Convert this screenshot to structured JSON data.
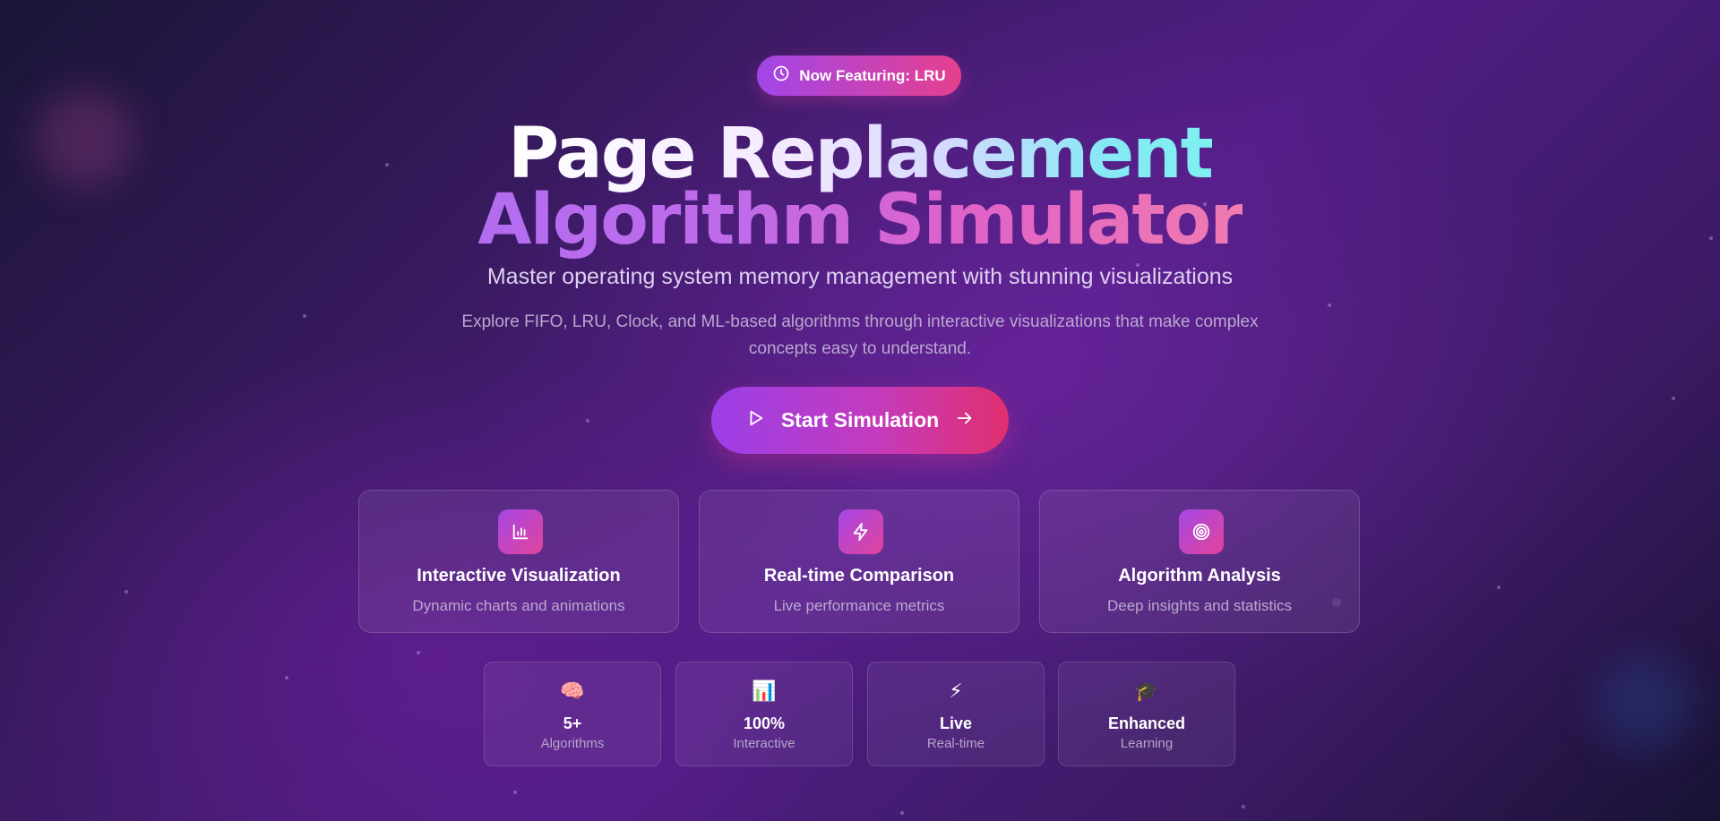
{
  "badge": {
    "icon": "clock-icon",
    "label": "Now Featuring: LRU"
  },
  "hero": {
    "title_line1": "Page Replacement",
    "title_line2": "Algorithm Simulator",
    "subtitle": "Master operating system memory management with stunning visualizations",
    "description": "Explore FIFO, LRU, Clock, and ML-based algorithms through interactive visualizations that make complex concepts easy to understand."
  },
  "cta": {
    "label": "Start Simulation",
    "icon_left": "play-icon",
    "icon_right": "arrow-right-icon"
  },
  "features": [
    {
      "icon": "bar-chart-icon",
      "title": "Interactive Visualization",
      "description": "Dynamic charts and animations"
    },
    {
      "icon": "lightning-icon",
      "title": "Real-time Comparison",
      "description": "Live performance metrics"
    },
    {
      "icon": "target-icon",
      "title": "Algorithm Analysis",
      "description": "Deep insights and statistics"
    }
  ],
  "stats": [
    {
      "icon": "brain-icon",
      "emoji": "🧠",
      "value": "5+",
      "label": "Algorithms"
    },
    {
      "icon": "chart-icon",
      "emoji": "📊",
      "value": "100%",
      "label": "Interactive"
    },
    {
      "icon": "lightning-icon",
      "emoji": "⚡",
      "value": "Live",
      "label": "Real-time"
    },
    {
      "icon": "graduation-cap-icon",
      "emoji": "🎓",
      "value": "Enhanced",
      "label": "Learning"
    }
  ],
  "colors": {
    "accent_purple": "#a146e8",
    "accent_pink": "#e6408e",
    "title_cyan": "#7ff0f0"
  }
}
